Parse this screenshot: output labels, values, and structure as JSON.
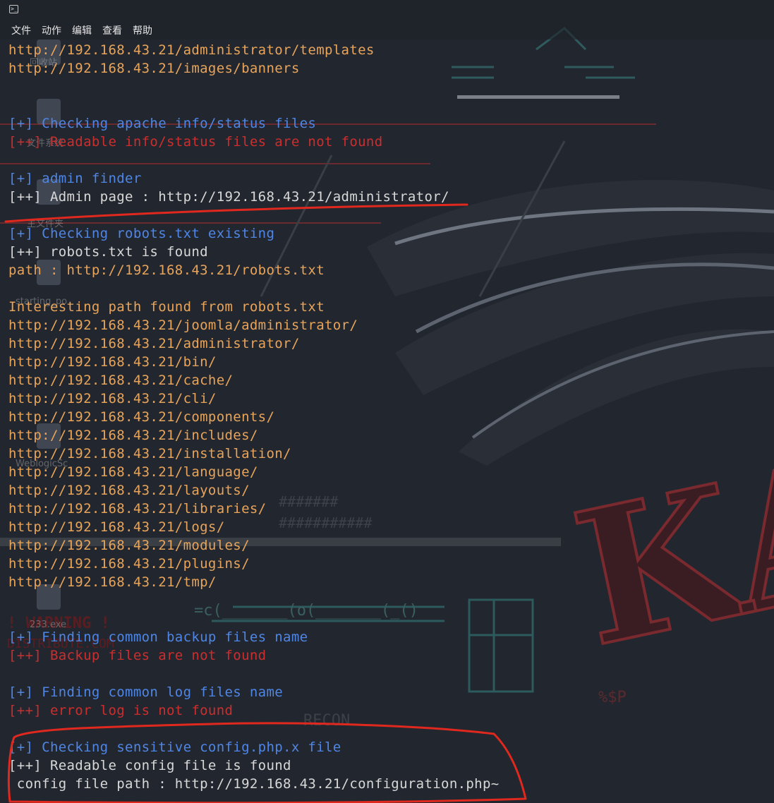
{
  "menu": [
    "文件",
    "动作",
    "编辑",
    "查看",
    "帮助"
  ],
  "terminal_lines": [
    {
      "text": "http://192.168.43.21/administrator/templates",
      "color": "orange"
    },
    {
      "text": "http://192.168.43.21/images/banners",
      "color": "orange"
    },
    {
      "text": "",
      "color": "orange"
    },
    {
      "text": "",
      "color": "orange"
    },
    {
      "text": "[+] Checking apache info/status files",
      "color": "blue"
    },
    {
      "text": "[++] Readable info/status files are not found",
      "color": "red"
    },
    {
      "text": "",
      "color": "orange"
    },
    {
      "text": "[+] admin finder",
      "color": "blue"
    },
    {
      "text": "[++] Admin page : http://192.168.43.21/administrator/",
      "color": "white"
    },
    {
      "text": "",
      "color": "orange"
    },
    {
      "text": "[+] Checking robots.txt existing",
      "color": "blue"
    },
    {
      "text": "[++] robots.txt is found",
      "color": "white"
    },
    {
      "text": "path : http://192.168.43.21/robots.txt",
      "color": "orange"
    },
    {
      "text": "",
      "color": "orange"
    },
    {
      "text": "Interesting path found from robots.txt",
      "color": "orange"
    },
    {
      "text": "http://192.168.43.21/joomla/administrator/",
      "color": "orange"
    },
    {
      "text": "http://192.168.43.21/administrator/",
      "color": "orange"
    },
    {
      "text": "http://192.168.43.21/bin/",
      "color": "orange"
    },
    {
      "text": "http://192.168.43.21/cache/",
      "color": "orange"
    },
    {
      "text": "http://192.168.43.21/cli/",
      "color": "orange"
    },
    {
      "text": "http://192.168.43.21/components/",
      "color": "orange"
    },
    {
      "text": "http://192.168.43.21/includes/",
      "color": "orange"
    },
    {
      "text": "http://192.168.43.21/installation/",
      "color": "orange"
    },
    {
      "text": "http://192.168.43.21/language/",
      "color": "orange"
    },
    {
      "text": "http://192.168.43.21/layouts/",
      "color": "orange"
    },
    {
      "text": "http://192.168.43.21/libraries/",
      "color": "orange"
    },
    {
      "text": "http://192.168.43.21/logs/",
      "color": "orange"
    },
    {
      "text": "http://192.168.43.21/modules/",
      "color": "orange"
    },
    {
      "text": "http://192.168.43.21/plugins/",
      "color": "orange"
    },
    {
      "text": "http://192.168.43.21/tmp/",
      "color": "orange"
    },
    {
      "text": "",
      "color": "orange"
    },
    {
      "text": "",
      "color": "orange"
    },
    {
      "text": "[+] Finding common backup files name",
      "color": "blue"
    },
    {
      "text": "[++] Backup files are not found",
      "color": "red"
    },
    {
      "text": "",
      "color": "orange"
    },
    {
      "text": "[+] Finding common log files name",
      "color": "blue"
    },
    {
      "text": "[++] error log is not found",
      "color": "red"
    },
    {
      "text": "",
      "color": "orange"
    },
    {
      "text": "[+] Checking sensitive config.php.x file",
      "color": "blue"
    },
    {
      "text": "[++] Readable config file is found",
      "color": "white"
    },
    {
      "text": " config file path : http://192.168.43.21/configuration.php~",
      "color": "white"
    }
  ],
  "colors": {
    "orange": "#e8a45a",
    "blue": "#4f86e6",
    "red": "#cc2e2e",
    "white": "#d8d8d8",
    "annotation": "#e0281e"
  },
  "wallpaper": {
    "logo_letters": "KAL",
    "label_recon": "RECON",
    "warning": "! WARNING !",
    "distribute": "DISTRIBUTE.COM",
    "dollar_p": "%$P"
  },
  "desktop_icons": [
    "回收站",
    "文件系统",
    "主文件夹",
    "starting_po",
    "WeblogicSc",
    "233.exe"
  ]
}
